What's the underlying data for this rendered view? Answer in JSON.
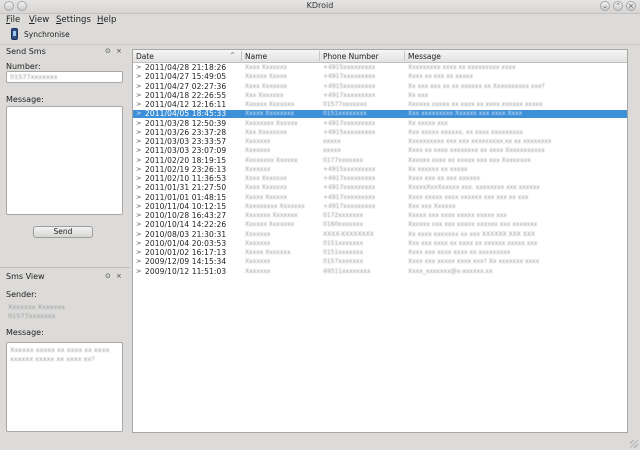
{
  "window": {
    "title": "KDroid"
  },
  "menu": [
    {
      "mnemonic": "F",
      "rest": "ile"
    },
    {
      "mnemonic": "V",
      "rest": "iew"
    },
    {
      "mnemonic": "S",
      "rest": "ettings"
    },
    {
      "mnemonic": "H",
      "rest": "elp"
    }
  ],
  "toolbar": {
    "sync_label": "Synchronise",
    "icon": "phone-icon"
  },
  "send_sms": {
    "title": "Send Sms",
    "number_label": "Number:",
    "number_value": "01577xxxxxxx",
    "message_label": "Message:",
    "send_label": "Send"
  },
  "sms_view": {
    "title": "Sms View",
    "sender_label": "Sender:",
    "sender_name": "Xxxxxxx Xxxxxxx",
    "sender_number": "01577xxxxxxx",
    "message_label": "Message:",
    "message_text": "Xxxxxx xxxxx xx xxxx xx xxxx xxxxxx xxxxx xx xxxx xx?"
  },
  "table": {
    "headers": [
      "Date",
      "Name",
      "Phone Number",
      "Message"
    ],
    "selected_index": 5,
    "rows": [
      {
        "date": "2011/04/28 21:18:26",
        "name": "Xxxx Xxxxxxx",
        "phone": "+4915xxxxxxxxx",
        "msg": "Xxxxxxxxx xxxx xx xxxxxxxxx xxxx"
      },
      {
        "date": "2011/04/27 15:49:05",
        "name": "Xxxxxx Xxxxx",
        "phone": "+4917xxxxxxxxx",
        "msg": "Xxxx xx xxx xx xxxxx"
      },
      {
        "date": "2011/04/27 02:27:36",
        "name": "Xxxx Xxxxxxx",
        "phone": "+4915xxxxxxxxx",
        "msg": "Xx xxx xxx xx xx xxxxxx xx Xxxxxxxxxx xxx?"
      },
      {
        "date": "2011/04/18 22:26:55",
        "name": "Xxx Xxxxxxx",
        "phone": "+4917xxxxxxxxx",
        "msg": "Xx xxx"
      },
      {
        "date": "2011/04/12 12:16:11",
        "name": "Xxxxxx Xxxxxxx",
        "phone": "01577xxxxxxx",
        "msg": "Xxxxxx xxxxx xx xxxx xx xxxx xxxxxx xxxxx"
      },
      {
        "date": "2011/04/05 18:45:33",
        "name": "Xxxxx Xxxxxxxx",
        "phone": "0151xxxxxxxx",
        "msg": "Xxx xxxxxxxxx Xxxxxx xxx xxxx Xxxx"
      },
      {
        "date": "2011/03/28 12:50:39",
        "name": "Xxxxxxxx Xxxxxx",
        "phone": "+4917xxxxxxxxx",
        "msg": "Xx xxxxx xxx"
      },
      {
        "date": "2011/03/26 23:37:28",
        "name": "Xxx Xxxxxxxx",
        "phone": "+4915xxxxxxxxx",
        "msg": "Xxx xxxxx xxxxxx, xx xxxx xxxxxxxxx"
      },
      {
        "date": "2011/03/03 23:33:57",
        "name": "Xxxxxxx",
        "phone": "xxxxx",
        "msg": "Xxxxxxxxxx xxx xxx xxxxxxxxx.xx xx xxxxxxxx"
      },
      {
        "date": "2011/03/03 23:07:09",
        "name": "Xxxxxxx",
        "phone": "xxxxx",
        "msg": "Xxxx xx xxxx xxxxxxxx xx xxxx Xxxxxxxxxxx"
      },
      {
        "date": "2011/02/20 18:19:15",
        "name": "Xxxxxxxx Xxxxxx",
        "phone": "0177xxxxxxx",
        "msg": "Xxxxxx xxxx xx xxxxx xxx xxx Xxxxxxxx"
      },
      {
        "date": "2011/02/19 23:26:13",
        "name": "Xxxxxxx",
        "phone": "+4915xxxxxxxxx",
        "msg": "Xx xxxxxx xx xxxxx"
      },
      {
        "date": "2011/02/10 11:36:53",
        "name": "Xxxx Xxxxxxx",
        "phone": "+4917xxxxxxxxx",
        "msg": "Xxxx xxx xx xxx xxxxxx"
      },
      {
        "date": "2011/01/31 21:27:50",
        "name": "Xxxx Xxxxxxx",
        "phone": "+4917xxxxxxxxx",
        "msg": "XxxxxXxxXxxxxx xxx. xxxxxxxx xxx xxxxxx"
      },
      {
        "date": "2011/01/01 01:48:15",
        "name": "Xxxxx Xxxxxx",
        "phone": "+4917xxxxxxxxx",
        "msg": "Xxxx xxxxx xxxx xxxxxx xxx xxx xx xxx"
      },
      {
        "date": "2010/11/04 10:12:15",
        "name": "Xxxxxxxxx Xxxxxxx",
        "phone": "+4917xxxxxxxxx",
        "msg": "Xxx xxx Xxxxxx"
      },
      {
        "date": "2010/10/28 16:43:27",
        "name": "Xxxxxxx Xxxxxxx",
        "phone": "0172xxxxxxx",
        "msg": "Xxxxx xxx xxxx xxxxx xxxxx xxx"
      },
      {
        "date": "2010/10/14 14:22:26",
        "name": "Xxxxxx Xxxxxxx",
        "phone": "0160xxxxxxx",
        "msg": "Xxxxxx xxx xxx xxxxx xxxxxx xxx xxxxxxx"
      },
      {
        "date": "2010/08/03 21:30:31",
        "name": "Xxxxxxx",
        "phone": "XXXX-XXXXXXXX",
        "msg": "Xx xxxx xxxxxxx xx xxx XXXXXX XXX XXX"
      },
      {
        "date": "2010/01/04 20:03:53",
        "name": "Xxxxxxx",
        "phone": "0151xxxxxxx",
        "msg": "Xxx xxx xxxx xx xxxx xx xxxxxx xxxxx xxx"
      },
      {
        "date": "2010/01/02 16:17:13",
        "name": "Xxxxx Xxxxxxx",
        "phone": "0151xxxxxxx",
        "msg": "Xxxx xxx xxxx xxxx xx xxxxxxxxx"
      },
      {
        "date": "2009/12/09 14:15:34",
        "name": "Xxxxxxx",
        "phone": "0157xxxxxxx",
        "msg": "Xxxx xxx xxxxx xxxx xxx? Xx xxxxxxx xxxx"
      },
      {
        "date": "2009/10/12 11:51:03",
        "name": "Xxxxxxx",
        "phone": "49511xxxxxxxx",
        "msg": "Xxxx_xxxxxxx@x-xxxxxx.xx"
      }
    ]
  }
}
